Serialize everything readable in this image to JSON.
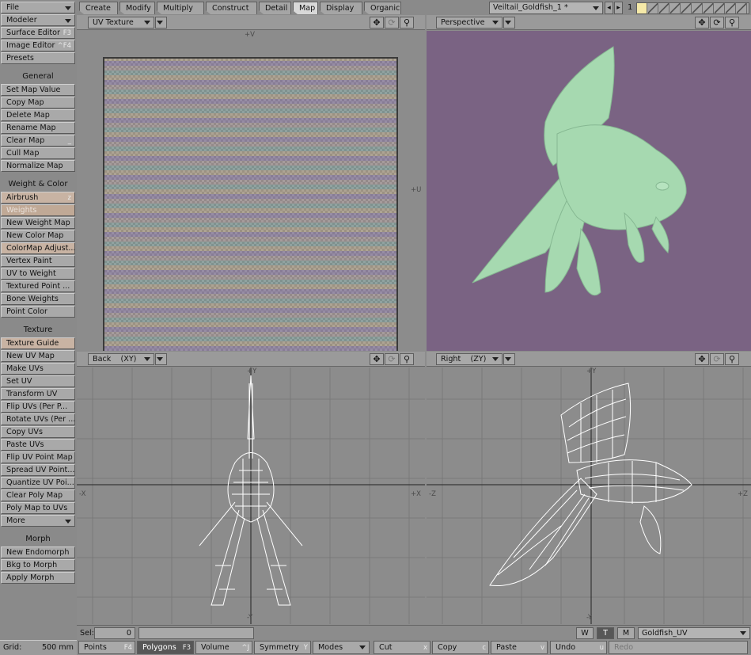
{
  "sidebar": {
    "file_label": "File",
    "modeler_label": "Modeler",
    "surface_editor": {
      "label": "Surface Editor",
      "shortcut": "F3"
    },
    "image_editor": {
      "label": "Image Editor",
      "shortcut": "^F4"
    },
    "presets": "Presets",
    "general_header": "General",
    "general_items": [
      "Set Map Value",
      "Copy Map",
      "Delete Map",
      "Rename Map",
      "Clear Map",
      "Cull Map",
      "Normalize Map"
    ],
    "clear_map_shortcut": "_",
    "weight_header": "Weight & Color",
    "airbrush": {
      "label": "Airbrush",
      "shortcut": "z"
    },
    "weights": "Weights",
    "weight_items": [
      "New Weight Map",
      "New Color Map",
      "ColorMap Adjust...",
      "Vertex Paint",
      "UV to Weight",
      "Textured Point ...",
      "Bone Weights",
      "Point Color"
    ],
    "texture_header": "Texture",
    "texture_items": [
      "Texture Guide",
      "New UV Map",
      "Make UVs",
      "Set UV",
      "Transform UV",
      "Flip UVs (Per P...",
      "Rotate UVs (Per ...",
      "Copy UVs",
      "Paste UVs",
      "Flip UV Point Map",
      "Spread UV Point...",
      "Quantize UV Poi...",
      "Clear Poly Map",
      "Poly Map to UVs"
    ],
    "more_label": "More",
    "morph_header": "Morph",
    "morph_items": [
      "New Endomorph",
      "Bkg to Morph",
      "Apply Morph"
    ],
    "grid_label": "Grid:",
    "grid_value": "500 mm"
  },
  "tabs": [
    "Create",
    "Modify",
    "Multiply",
    "Construct",
    "Detail",
    "Map",
    "Display",
    "Organic"
  ],
  "active_tab": "Map",
  "object_name": "Veiltail_Goldfish_1 *",
  "layer_number": "1",
  "viewports": {
    "uv": {
      "view": "UV Texture",
      "axis_top": "+V",
      "axis_right": "+U"
    },
    "perspective": {
      "view": "Perspective",
      "bg": "#7a6383",
      "fish": "#a6d9b0"
    },
    "back": {
      "view": "Back",
      "plane": "(XY)",
      "axis_top": "+Y",
      "axis_bottom": "-Y",
      "axis_left": "-X",
      "axis_right": "+X"
    },
    "right": {
      "view": "Right",
      "plane": "(ZY)",
      "axis_top": "+Y",
      "axis_bottom": "-Y",
      "axis_left": "-Z",
      "axis_right": "+Z"
    }
  },
  "viewport_controls": {
    "move": "move-icon",
    "rotate": "rotate-icon",
    "zoom": "zoom-icon"
  },
  "selection": {
    "label": "Sel:",
    "value": "0"
  },
  "wtm": [
    "W",
    "T",
    "M"
  ],
  "wtm_active": "T",
  "vmap_name": "Goldfish_UV",
  "modes": [
    {
      "label": "Points",
      "key": "F4"
    },
    {
      "label": "Polygons",
      "key": "F3"
    },
    {
      "label": "Volume",
      "key": "^J"
    },
    {
      "label": "Symmetry",
      "key": "Y"
    },
    {
      "label": "Modes",
      "key": ""
    }
  ],
  "edit_actions": [
    {
      "label": "Cut",
      "key": "x"
    },
    {
      "label": "Copy",
      "key": "c"
    },
    {
      "label": "Paste",
      "key": "v"
    },
    {
      "label": "Undo",
      "key": "u"
    },
    {
      "label": "Redo",
      "key": ""
    }
  ]
}
